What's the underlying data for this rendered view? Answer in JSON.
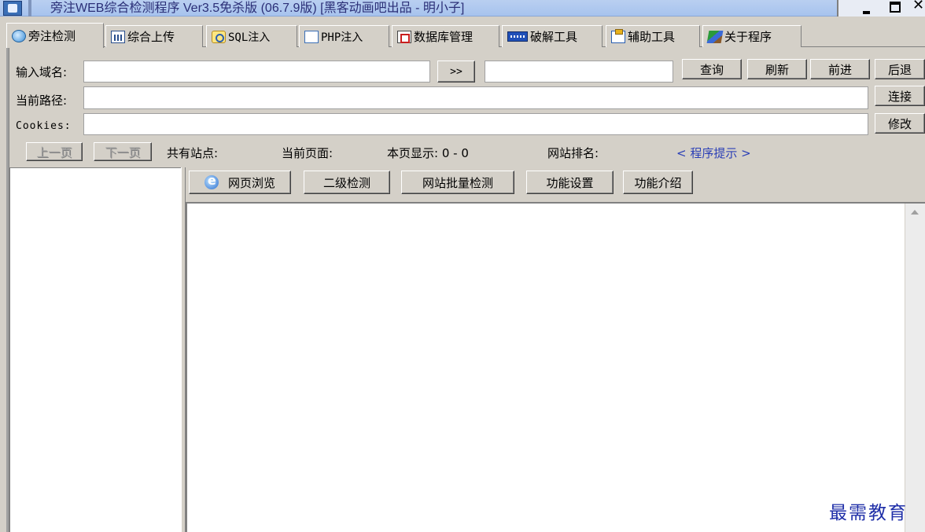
{
  "window": {
    "title": "旁注WEB综合检测程序 Ver3.5免杀版 (06.7.9版) [黑客动画吧出品 - 明小子]",
    "minimize_label": "",
    "close_label": "✕"
  },
  "tabs": [
    {
      "label": "旁注检测",
      "icon": "globe-icon"
    },
    {
      "label": "综合上传",
      "icon": "chart-icon"
    },
    {
      "label": "SQL注入",
      "icon": "search-icon"
    },
    {
      "label": "PHP注入",
      "icon": "page-search-icon"
    },
    {
      "label": "数据库管理",
      "icon": "database-icon"
    },
    {
      "label": "破解工具",
      "icon": "keyboard-icon"
    },
    {
      "label": "辅助工具",
      "icon": "clipboard-icon"
    },
    {
      "label": "关于程序",
      "icon": "book-icon"
    }
  ],
  "form": {
    "domain_label": "输入域名:",
    "domain_value": "",
    "go_button": ">>",
    "result_value": "",
    "query_button": "查询",
    "refresh_button": "刷新",
    "forward_button": "前进",
    "back_button": "后退",
    "path_label": "当前路径:",
    "path_value": "",
    "connect_button": "连接",
    "cookies_label": "Cookies:",
    "cookies_value": "",
    "modify_button": "修改"
  },
  "pager": {
    "prev_button": "上一页",
    "next_button": "下一页",
    "total_sites_label": "共有站点:",
    "current_page_label": "当前页面:",
    "page_display_label": "本页显示: 0 - 0",
    "site_rank_label": "网站排名:",
    "program_hint": "< 程序提示 >"
  },
  "subtoolbar": {
    "browse_button": "网页浏览",
    "second_level_button": "二级检测",
    "batch_button": "网站批量检测",
    "settings_button": "功能设置",
    "intro_button": "功能介绍"
  },
  "watermark": "最需教育",
  "colors": {
    "titlebar": "#a7c3ee",
    "title_text": "#2b2f77",
    "face": "#d4d0c8",
    "link": "#2b3fb6",
    "watermark": "#1f2fa8"
  }
}
